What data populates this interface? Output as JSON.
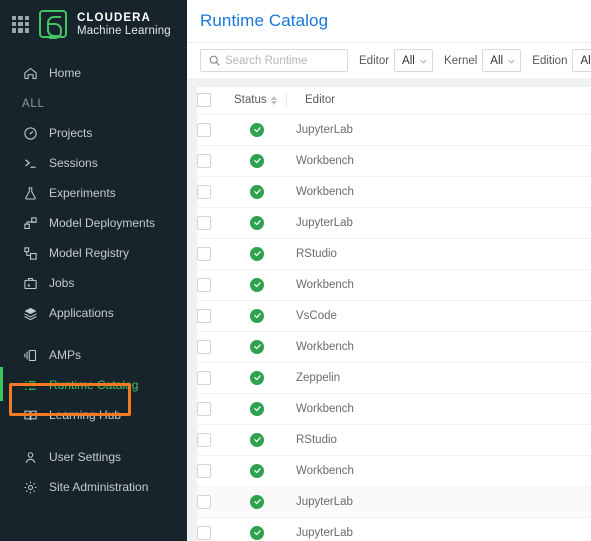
{
  "sidebar": {
    "apps_icon": "grid-icon",
    "brand": {
      "line1": "CLOUDERA",
      "line2": "Machine Learning"
    },
    "home": {
      "label": "Home",
      "icon": "home-icon"
    },
    "section_label": "ALL",
    "items": [
      {
        "label": "Projects",
        "icon": "projects-icon"
      },
      {
        "label": "Sessions",
        "icon": "terminal-icon"
      },
      {
        "label": "Experiments",
        "icon": "flask-icon"
      },
      {
        "label": "Model Deployments",
        "icon": "deployments-icon"
      },
      {
        "label": "Model Registry",
        "icon": "registry-icon"
      },
      {
        "label": "Jobs",
        "icon": "jobs-icon"
      },
      {
        "label": "Applications",
        "icon": "layers-icon"
      }
    ],
    "items2": [
      {
        "label": "AMPs",
        "icon": "amps-icon",
        "active": false
      },
      {
        "label": "Runtime Catalog",
        "icon": "list-icon",
        "active": true
      },
      {
        "label": "Learning Hub",
        "icon": "book-icon",
        "active": false
      }
    ],
    "items3": [
      {
        "label": "User Settings",
        "icon": "user-icon"
      },
      {
        "label": "Site Administration",
        "icon": "gear-icon"
      }
    ],
    "active_highlight_color": "#3ec45e",
    "annotation_color": "#f47b20"
  },
  "header": {
    "title": "Runtime Catalog",
    "title_color": "#1677d9"
  },
  "toolbar": {
    "search": {
      "value": "",
      "placeholder": "Search Runtime",
      "icon": "search-icon"
    },
    "filters": [
      {
        "label": "Editor",
        "value": "All"
      },
      {
        "label": "Kernel",
        "value": "All"
      },
      {
        "label": "Edition",
        "value": "All"
      }
    ]
  },
  "table": {
    "columns": [
      {
        "key": "checkbox",
        "label": ""
      },
      {
        "key": "status",
        "label": "Status",
        "sortable": true
      },
      {
        "key": "editor",
        "label": "Editor",
        "sortable": false
      }
    ],
    "status_icon": "check-circle-icon",
    "status_color": "#30a14e",
    "rows": [
      {
        "status": "ok",
        "editor": "JupyterLab",
        "checked": false,
        "hovered": false
      },
      {
        "status": "ok",
        "editor": "Workbench",
        "checked": false,
        "hovered": false
      },
      {
        "status": "ok",
        "editor": "Workbench",
        "checked": false,
        "hovered": false
      },
      {
        "status": "ok",
        "editor": "JupyterLab",
        "checked": false,
        "hovered": false
      },
      {
        "status": "ok",
        "editor": "RStudio",
        "checked": false,
        "hovered": false
      },
      {
        "status": "ok",
        "editor": "Workbench",
        "checked": false,
        "hovered": false
      },
      {
        "status": "ok",
        "editor": "VsCode",
        "checked": false,
        "hovered": false
      },
      {
        "status": "ok",
        "editor": "Workbench",
        "checked": false,
        "hovered": false
      },
      {
        "status": "ok",
        "editor": "Zeppelin",
        "checked": false,
        "hovered": false
      },
      {
        "status": "ok",
        "editor": "Workbench",
        "checked": false,
        "hovered": false
      },
      {
        "status": "ok",
        "editor": "RStudio",
        "checked": false,
        "hovered": false
      },
      {
        "status": "ok",
        "editor": "Workbench",
        "checked": false,
        "hovered": false
      },
      {
        "status": "ok",
        "editor": "JupyterLab",
        "checked": false,
        "hovered": true
      },
      {
        "status": "ok",
        "editor": "JupyterLab",
        "checked": false,
        "hovered": false
      }
    ]
  }
}
